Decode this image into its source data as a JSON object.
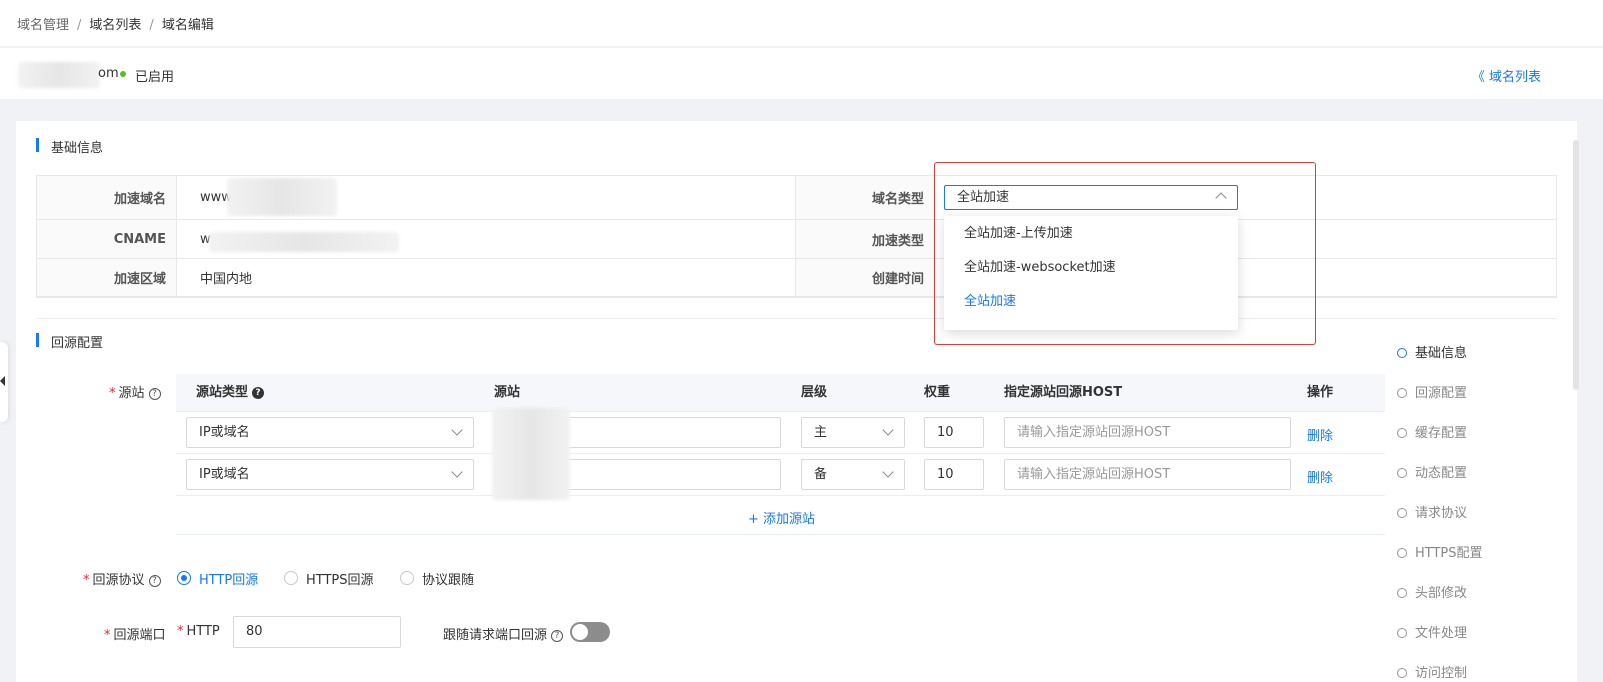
{
  "breadcrumb": {
    "items": [
      "域名管理",
      "域名列表",
      "域名编辑"
    ],
    "separator": "/"
  },
  "domain_bar": {
    "domain_tail": "om",
    "status": "已启用",
    "back_link": "《 域名列表",
    "status_color": "#52c41a"
  },
  "basic_info": {
    "title": "基础信息",
    "rows": [
      {
        "label": "加速域名",
        "value": "www.",
        "right_label": "域名类型"
      },
      {
        "label": "CNAME",
        "value": "w",
        "right_label": "加速类型"
      },
      {
        "label": "加速区域",
        "value": "中国内地",
        "right_label": "创建时间"
      }
    ]
  },
  "domain_type_select": {
    "value": "全站加速",
    "options": [
      "全站加速-上传加速",
      "全站加速-websocket加速",
      "全站加速"
    ],
    "selected_index": 2
  },
  "origin_config": {
    "title": "回源配置",
    "origin_label": "源站",
    "columns": [
      "源站类型",
      "源站",
      "层级",
      "权重",
      "指定源站回源HOST",
      "操作"
    ],
    "rows": [
      {
        "type": "IP或域名",
        "level": "主",
        "weight": "10",
        "host_placeholder": "请输入指定源站回源HOST",
        "action": "删除"
      },
      {
        "type": "IP或域名",
        "level": "备",
        "weight": "10",
        "host_placeholder": "请输入指定源站回源HOST",
        "action": "删除"
      }
    ],
    "add_label": "+ 添加源站"
  },
  "protocol": {
    "label": "回源协议",
    "options": [
      "HTTP回源",
      "HTTPS回源",
      "协议跟随"
    ],
    "selected": "HTTP回源"
  },
  "port": {
    "label": "回源端口",
    "http_label": "HTTP",
    "http_value": "80",
    "follow_label": "跟随请求端口回源",
    "follow_enabled": false
  },
  "anchor_nav": {
    "items": [
      "基础信息",
      "回源配置",
      "缓存配置",
      "动态配置",
      "请求协议",
      "HTTPS配置",
      "头部修改",
      "文件处理",
      "访问控制"
    ],
    "active": "基础信息"
  },
  "colors": {
    "accent": "#1677ff",
    "required": "#f5222d",
    "highlight_box": "#e53935"
  }
}
